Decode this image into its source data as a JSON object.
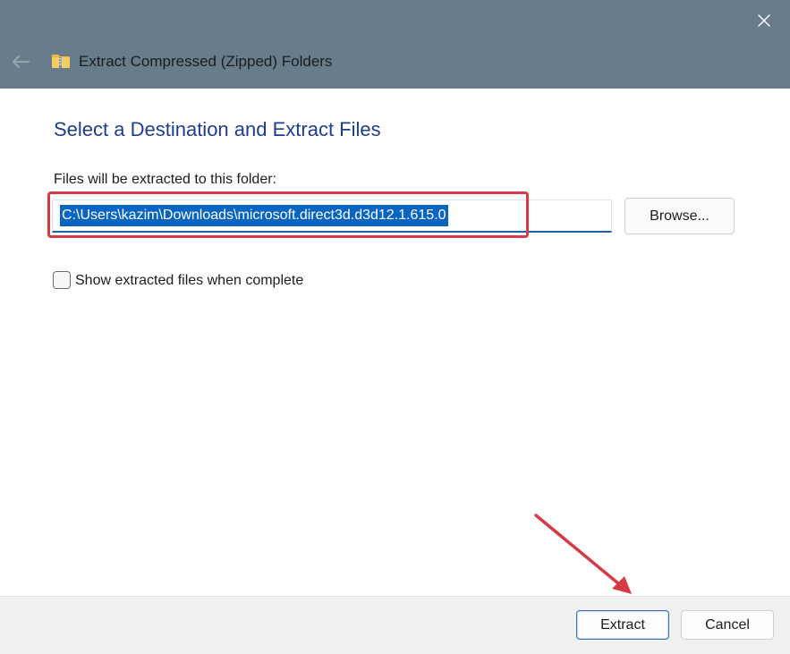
{
  "window": {
    "title": "Extract Compressed (Zipped) Folders",
    "titlebar_color": "#677d8b",
    "icons": {
      "back": "back-arrow-icon",
      "close": "close-icon",
      "app": "zip-folder-icon"
    }
  },
  "main": {
    "heading": "Select a Destination and Extract Files",
    "heading_color": "#1e3d8f",
    "field_label": "Files will be extracted to this folder:",
    "path_value": "C:\\Users\\kazim\\Downloads\\microsoft.direct3d.d3d12.1.615.0",
    "selection_color": "#0a65c2",
    "browse_label": "Browse...",
    "checkbox_label": "Show extracted files when complete",
    "checkbox_checked": false
  },
  "footer": {
    "extract_label": "Extract",
    "cancel_label": "Cancel"
  },
  "annotations": {
    "highlight_color": "#d63a44"
  }
}
